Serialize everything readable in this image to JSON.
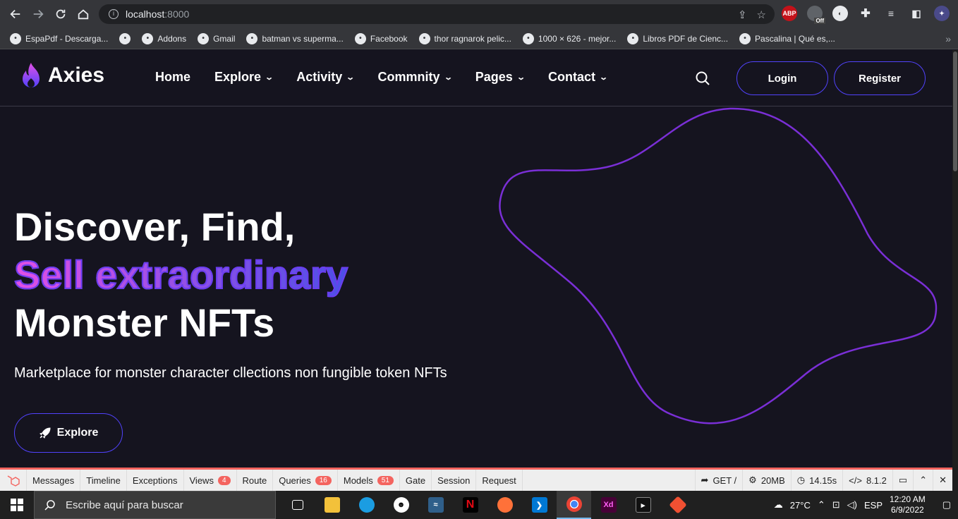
{
  "browser": {
    "url_host": "localhost",
    "url_port": ":8000",
    "bookmarks": [
      {
        "label": "EspaPdf - Descarga...",
        "icon": "globe-icon"
      },
      {
        "label": "",
        "icon": "globe-icon"
      },
      {
        "label": "Addons",
        "icon": "addons-icon"
      },
      {
        "label": "Gmail",
        "icon": "google-icon"
      },
      {
        "label": "batman vs superma...",
        "icon": "globe-icon"
      },
      {
        "label": "Facebook",
        "icon": "facebook-icon"
      },
      {
        "label": "thor ragnarok pelic...",
        "icon": "google-icon"
      },
      {
        "label": "1000 × 626 - mejor...",
        "icon": "google-icon"
      },
      {
        "label": "Libros PDF de Cienc...",
        "icon": "libros-icon"
      },
      {
        "label": "Pascalina | Qué es,...",
        "icon": "pascalina-icon"
      }
    ],
    "bookmarks_more": "»",
    "ext_abp": "ABP",
    "ext_off": "Off"
  },
  "site": {
    "brand": "Axies",
    "nav": [
      "Home",
      "Explore",
      "Activity",
      "Commnity",
      "Pages",
      "Contact"
    ],
    "login_label": "Login",
    "register_label": "Register",
    "hero_line1": "Discover, Find,",
    "hero_line2": "Sell extraordinary",
    "hero_line3": "Monster NFTs",
    "hero_sub": "Marketplace for monster character cllections non fungible token NFTs",
    "explore_label": "Explore",
    "colors": {
      "accent": "#5142fc",
      "bg": "#15141f",
      "blob": "#7a2fd6"
    }
  },
  "debugbar": {
    "tabs": [
      {
        "label": "Messages",
        "badge": ""
      },
      {
        "label": "Timeline",
        "badge": ""
      },
      {
        "label": "Exceptions",
        "badge": ""
      },
      {
        "label": "Views",
        "badge": "4"
      },
      {
        "label": "Route",
        "badge": ""
      },
      {
        "label": "Queries",
        "badge": "16"
      },
      {
        "label": "Models",
        "badge": "51"
      },
      {
        "label": "Gate",
        "badge": ""
      },
      {
        "label": "Session",
        "badge": ""
      },
      {
        "label": "Request",
        "badge": ""
      }
    ],
    "method": "GET /",
    "memory": "20MB",
    "time": "14.15s",
    "php": "8.1.2"
  },
  "taskbar": {
    "search_placeholder": "Escribe aquí para buscar",
    "temperature": "27°C",
    "language": "ESP",
    "time": "12:20 AM",
    "date": "6/9/2022",
    "app_xd": "Xd",
    "app_netflix": "N"
  }
}
